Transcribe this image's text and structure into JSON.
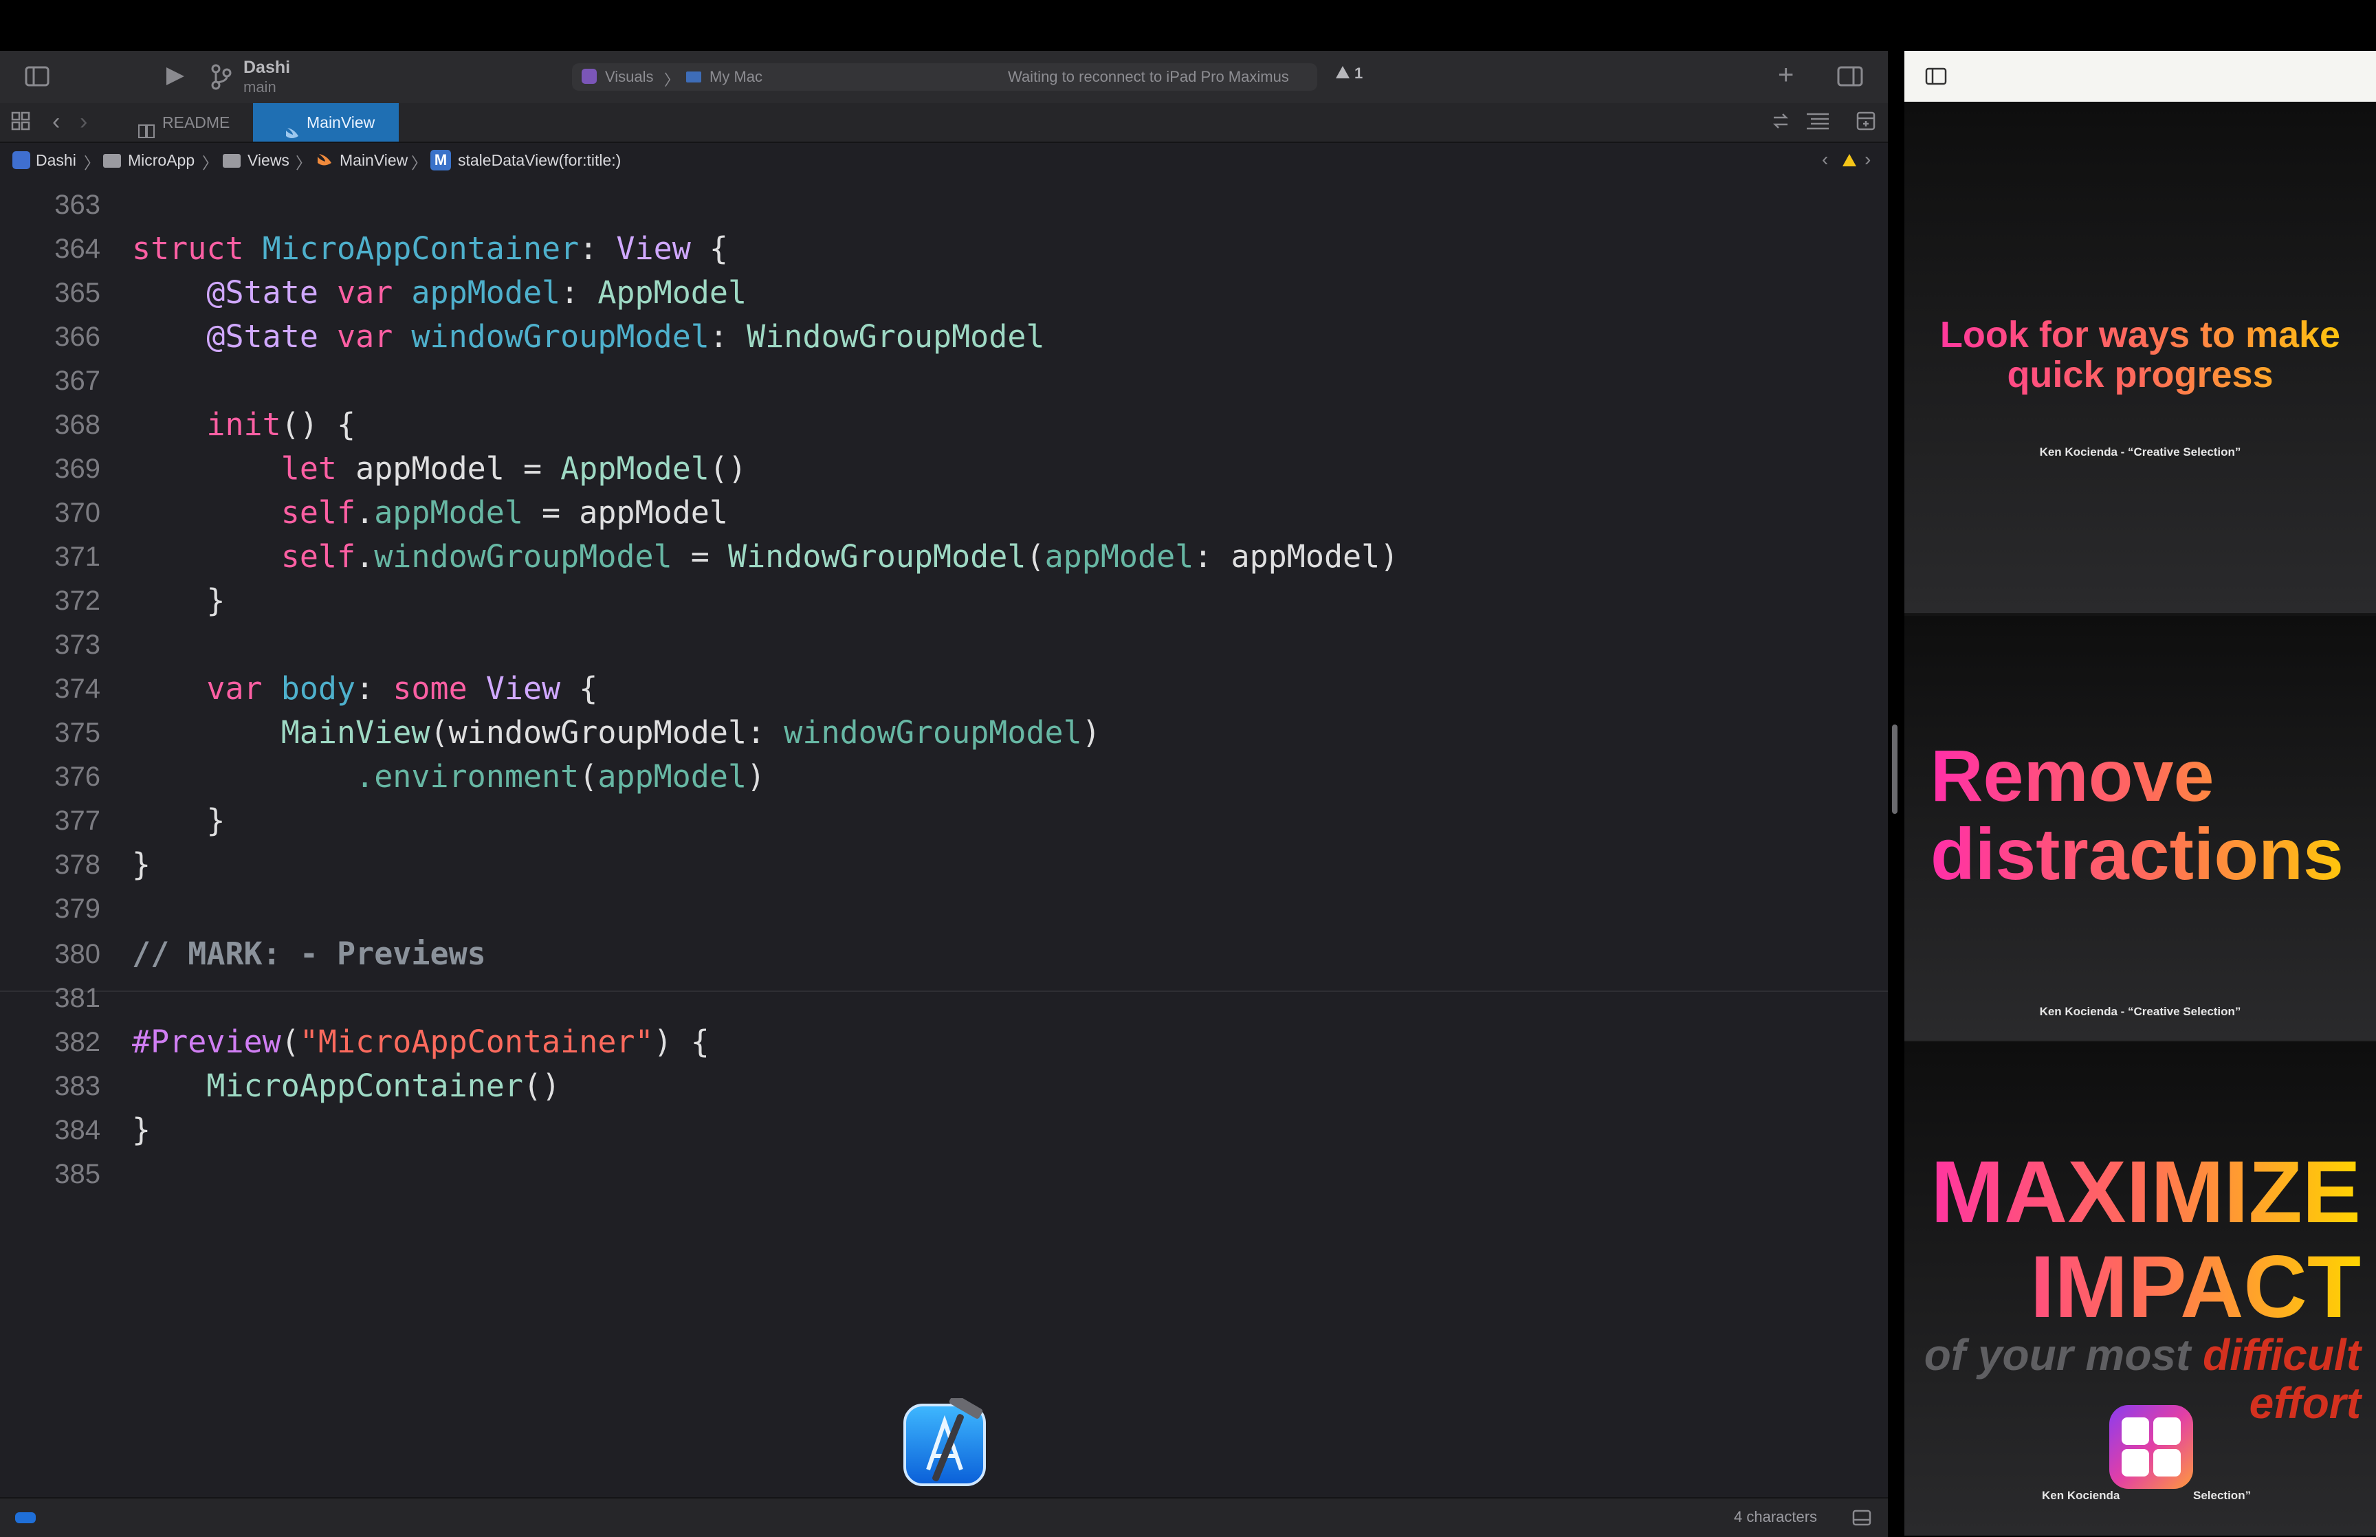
{
  "toolbar": {
    "scheme_name": "Dashi",
    "branch": "main",
    "destination_scheme": "Visuals",
    "destination_device": "My Mac",
    "activity_status": "Waiting to reconnect to iPad Pro Maximus",
    "warning_count": "1"
  },
  "tabs": [
    {
      "label": "README",
      "active": false
    },
    {
      "label": "MainView",
      "active": true
    }
  ],
  "jumpbar": {
    "crumbs": [
      "Dashi",
      "MicroApp",
      "Views",
      "MainView",
      "staleDataView(for:title:)"
    ],
    "method_badge": "M"
  },
  "code": {
    "lines": [
      {
        "n": "363"
      },
      {
        "n": "364"
      },
      {
        "n": "365"
      },
      {
        "n": "366"
      },
      {
        "n": "367"
      },
      {
        "n": "368"
      },
      {
        "n": "369"
      },
      {
        "n": "370"
      },
      {
        "n": "371"
      },
      {
        "n": "372"
      },
      {
        "n": "373"
      },
      {
        "n": "374"
      },
      {
        "n": "375"
      },
      {
        "n": "376"
      },
      {
        "n": "377"
      },
      {
        "n": "378"
      },
      {
        "n": "379"
      },
      {
        "n": "380"
      },
      {
        "n": "381"
      },
      {
        "n": "382"
      },
      {
        "n": "383"
      },
      {
        "n": "384"
      },
      {
        "n": "385"
      }
    ],
    "tokens": {
      "struct": "struct",
      "container": "MicroAppContainer",
      "view": "View",
      "state": "@State",
      "var": "var",
      "appModel": "appModel",
      "AppModel": "AppModel",
      "windowGroupModel": "windowGroupModel",
      "WindowGroupModel": "WindowGroupModel",
      "init": "init",
      "let": "let",
      "self": "self",
      "body": "body",
      "some": "some",
      "MainView": "MainView",
      "environment": ".environment",
      "mark": "// MARK: - Previews",
      "preview": "#Preview",
      "preview_string": "\"MicroAppContainer\""
    }
  },
  "statusbar": {
    "selection": "4 characters"
  },
  "slides": [
    {
      "title_line1": "Look for ways to make",
      "title_line2": "quick progress",
      "credit": "Ken Kocienda - “Creative Selection”"
    },
    {
      "title_line1": "Remove",
      "title_line2": "distractions",
      "credit": "Ken Kocienda - “Creative Selection”"
    },
    {
      "title_line1": "MAXIMIZE",
      "title_line2": "IMPACT",
      "sub_part1": "of your most",
      "sub_part2": "difficult",
      "sub_part3": "effort",
      "credit_left": "Ken Kocienda",
      "credit_right": "Selection”"
    }
  ],
  "colors": {
    "editor_bg": "#1f1f24",
    "keyword": "#fc5fa3",
    "type": "#d0a8ff",
    "identifier": "#4eb0cc",
    "string": "#fc6a5d",
    "comment": "#8b929b",
    "tab_active": "#1f6fb3"
  }
}
